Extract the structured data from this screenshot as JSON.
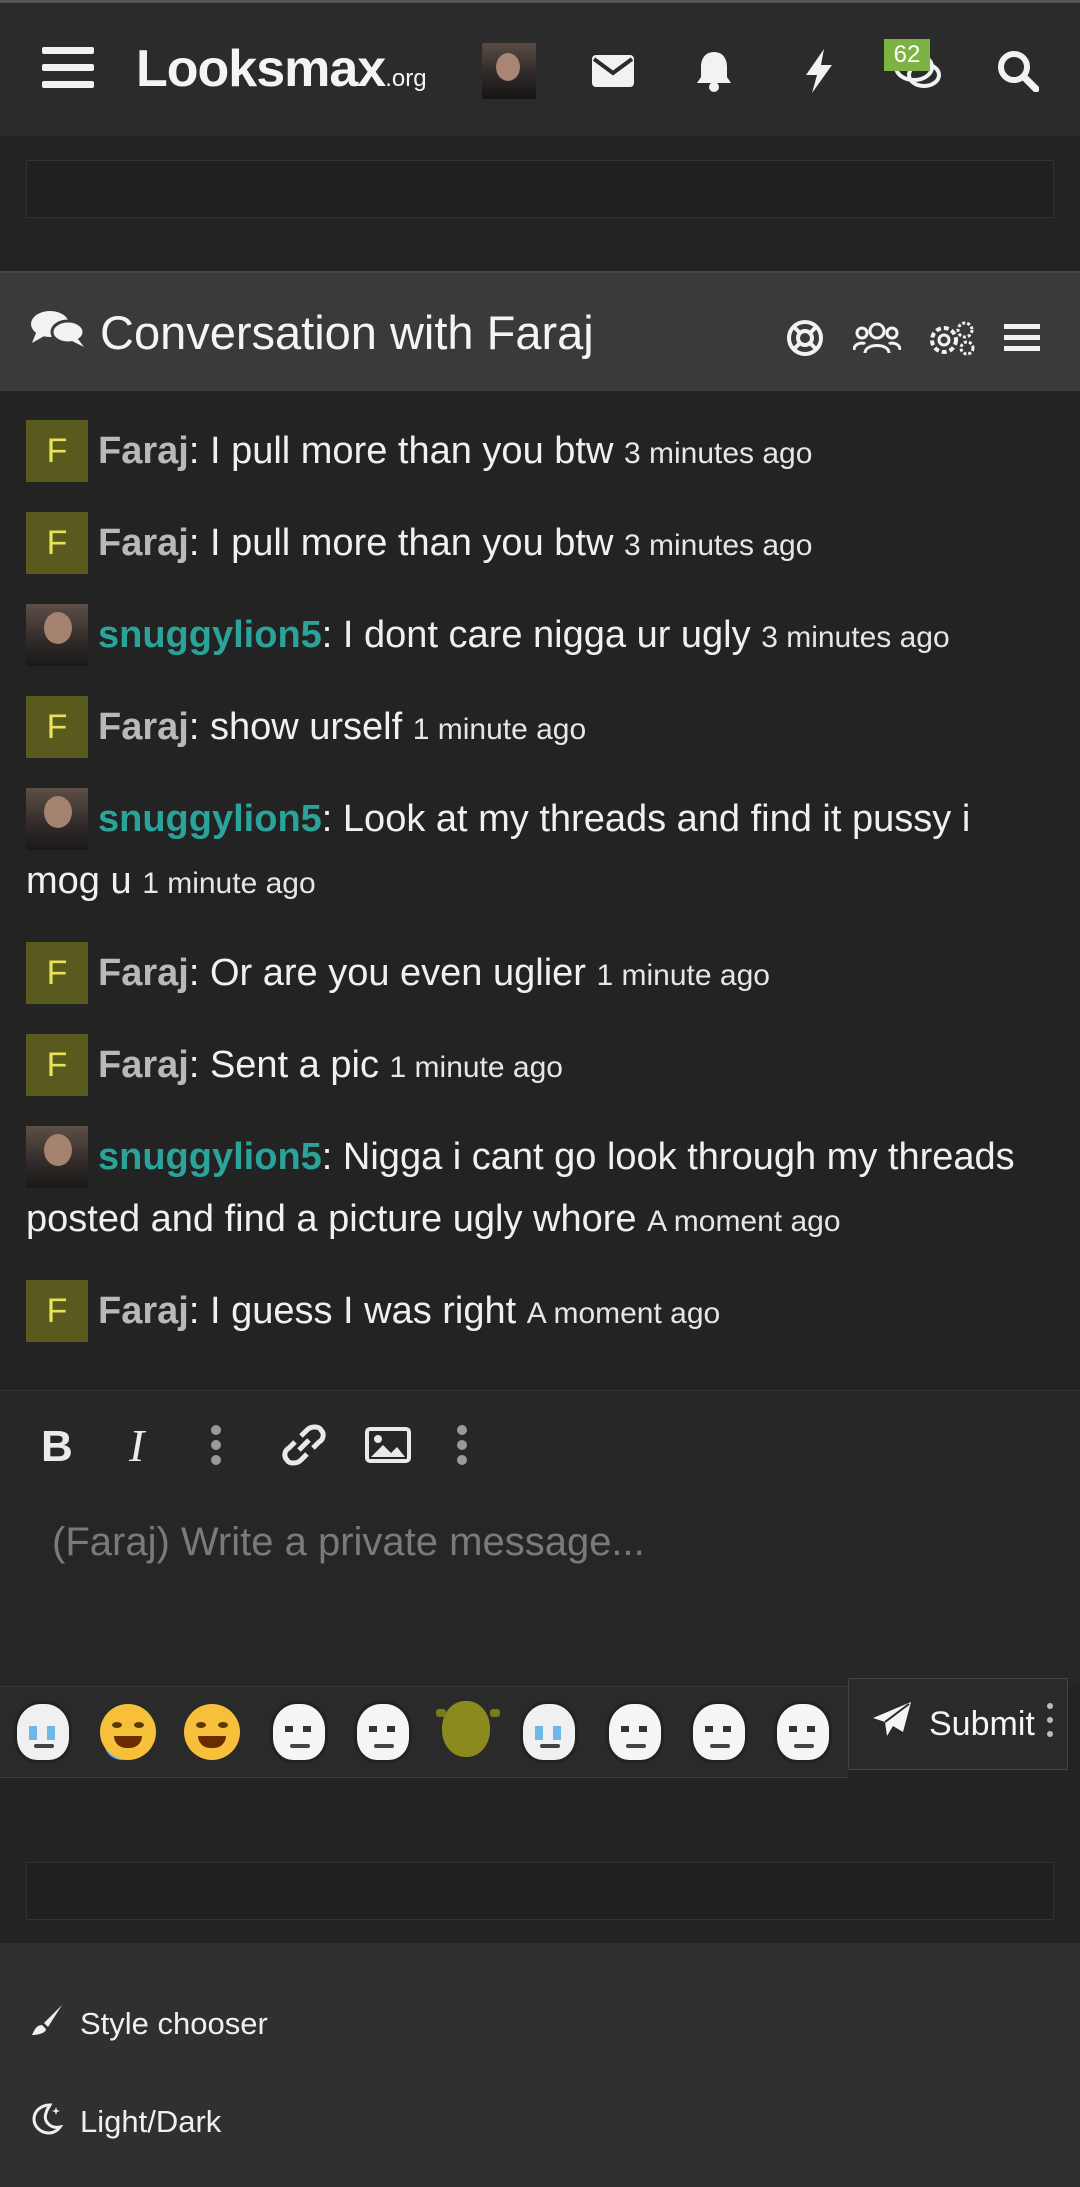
{
  "header": {
    "logo_main": "Looksmax",
    "logo_suffix": ".org",
    "badge_count": "62",
    "badge_color": "#7cb342",
    "icons": [
      "menu-icon",
      "avatar",
      "envelope-icon",
      "bell-icon",
      "bolt-icon",
      "chat-icon",
      "search-icon"
    ]
  },
  "conversation": {
    "title": "Conversation with Faraj",
    "header_icons": [
      "lifebuoy-icon",
      "users-icon",
      "gears-icon",
      "menu-icon"
    ]
  },
  "messages": [
    {
      "avatar": "F",
      "user": "Faraj",
      "text": "I pull more than you btw",
      "time": "3 minutes ago"
    },
    {
      "avatar": "F",
      "user": "Faraj",
      "text": "I pull more than you btw",
      "time": "3 minutes ago"
    },
    {
      "avatar": "photo",
      "user": "snuggylion5",
      "text": "I dont care nigga ur ugly",
      "time": "3 minutes ago"
    },
    {
      "avatar": "F",
      "user": "Faraj",
      "text": "show urself",
      "time": "1 minute ago"
    },
    {
      "avatar": "photo",
      "user": "snuggylion5",
      "text": "Look at my threads and find it pussy i mog u",
      "time": "1 minute ago"
    },
    {
      "avatar": "F",
      "user": "Faraj",
      "text": "Or are you even uglier",
      "time": "1 minute ago"
    },
    {
      "avatar": "F",
      "user": "Faraj",
      "text": "Sent a pic",
      "time": "1 minute ago"
    },
    {
      "avatar": "photo",
      "user": "snuggylion5",
      "text": "Nigga i cant go look through my threads posted and find a picture ugly whore",
      "time": "A moment ago"
    },
    {
      "avatar": "F",
      "user": "Faraj",
      "text": "I guess I was right",
      "time": "A moment ago"
    }
  ],
  "user_colors": {
    "Faraj": "#b9b9b9",
    "snuggylion5": "#2aa39a"
  },
  "editor": {
    "toolbar": [
      "bold-icon",
      "italic-icon",
      "more-icon",
      "link-icon",
      "image-icon",
      "more-icon"
    ],
    "placeholder": "(Faraj) Write a private message...",
    "submit_label": "Submit"
  },
  "emojis": [
    "crying-wojak",
    "tears-of-joy",
    "grin-emoji",
    "glasses-wojak",
    "wojak",
    "shrek",
    "crying-wojak",
    "sad-wojak",
    "wojak",
    "glasses-wojak"
  ],
  "footer": {
    "style_chooser": "Style chooser",
    "light_dark": "Light/Dark"
  }
}
